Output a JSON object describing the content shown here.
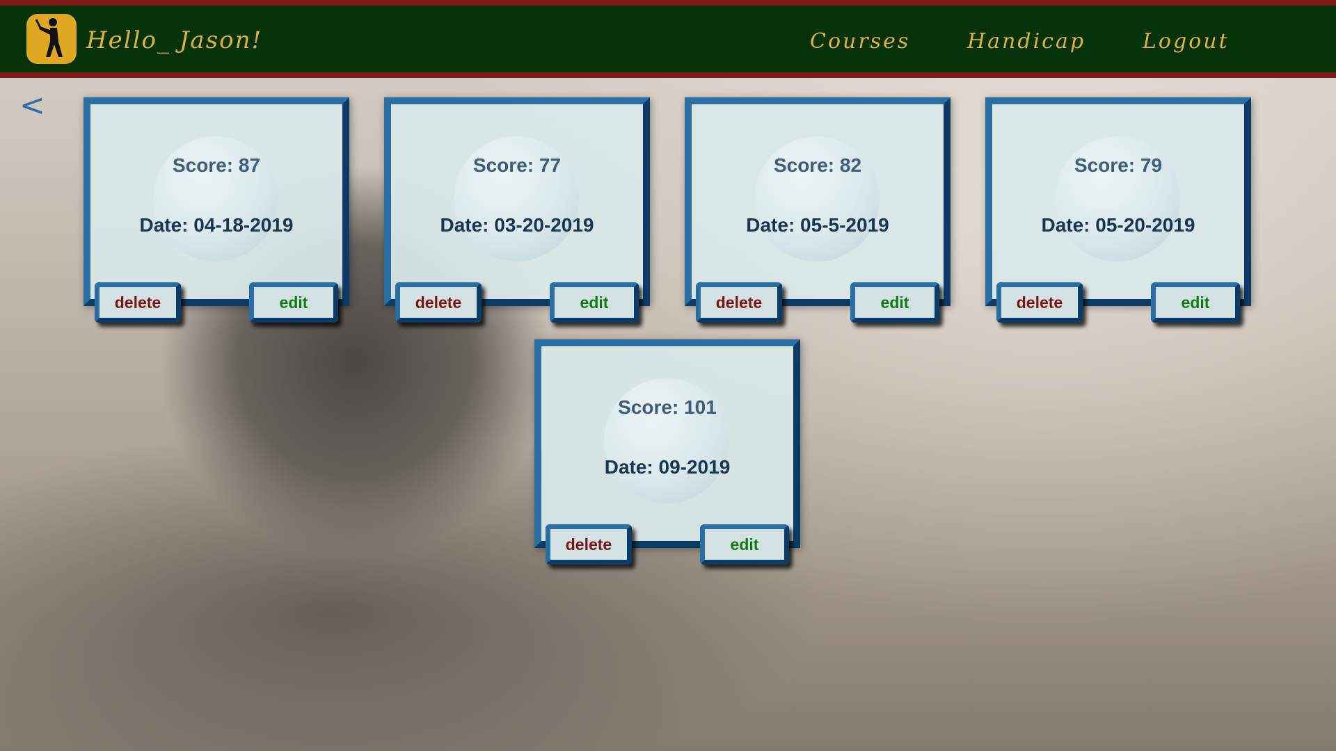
{
  "header": {
    "greeting": "Hello_ Jason!",
    "logo_icon": "golfer-icon",
    "nav": [
      {
        "label": "Courses"
      },
      {
        "label": "Handicap"
      },
      {
        "label": "Logout"
      }
    ]
  },
  "back_label": "<",
  "rounds": [
    {
      "score": "Score: 87",
      "date": "Date: 04-18-2019",
      "delete_label": "delete",
      "edit_label": "edit"
    },
    {
      "score": "Score: 77",
      "date": "Date: 03-20-2019",
      "delete_label": "delete",
      "edit_label": "edit"
    },
    {
      "score": "Score: 82",
      "date": "Date: 05-5-2019",
      "delete_label": "delete",
      "edit_label": "edit"
    },
    {
      "score": "Score: 79",
      "date": "Date: 05-20-2019",
      "delete_label": "delete",
      "edit_label": "edit"
    },
    {
      "score": "Score: 101",
      "date": "Date: 09-2019",
      "delete_label": "delete",
      "edit_label": "edit"
    }
  ],
  "colors": {
    "navbar": "#053208",
    "accent_line": "#7a1a1a",
    "nav_text": "#e3b232",
    "card_border": "#2a6fa3",
    "delete_text": "#7b1414",
    "edit_text": "#127a12"
  }
}
